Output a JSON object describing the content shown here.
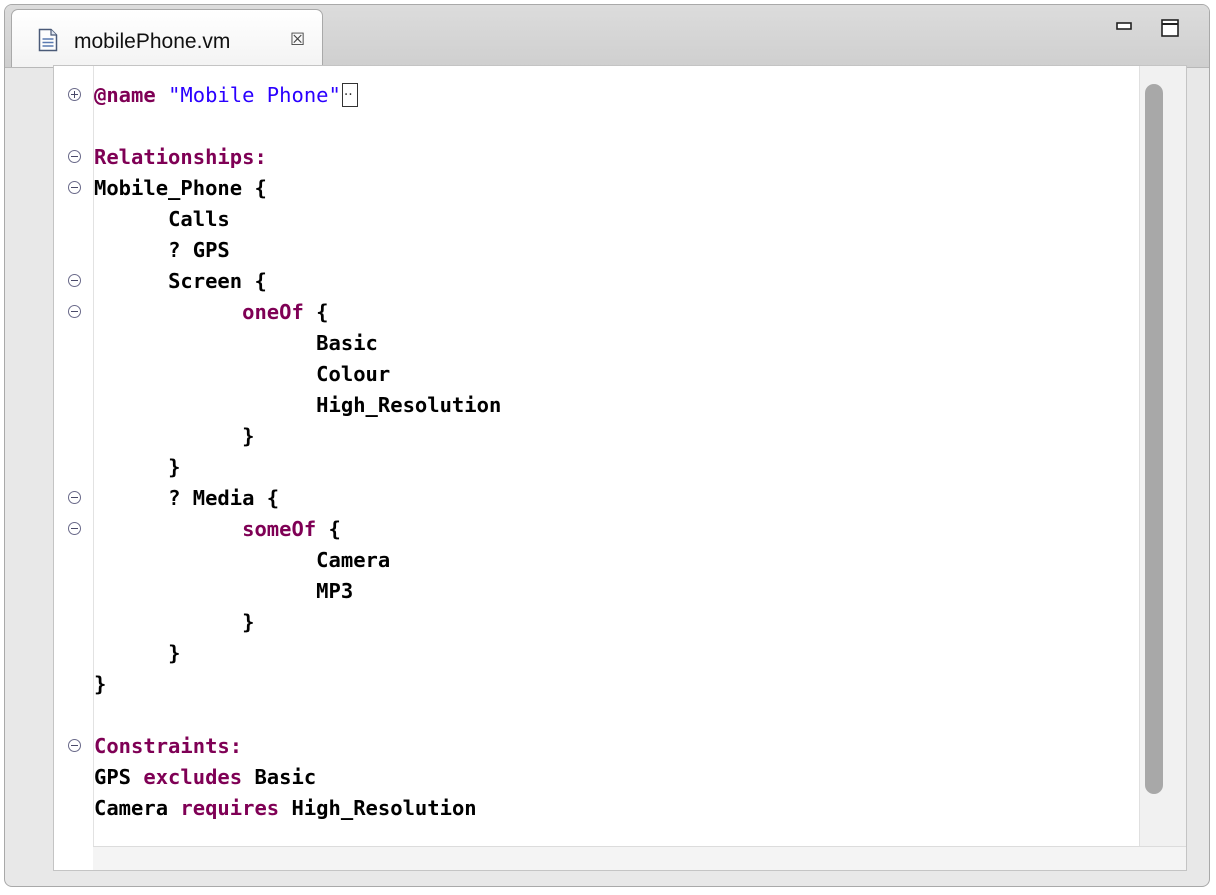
{
  "tab": {
    "file_name": "mobilePhone.vm",
    "close_glyph": "☒"
  },
  "icons": {
    "file": "text-file-icon",
    "close": "close-tab-icon",
    "minimize": "minimize-icon",
    "maximize": "maximize-icon",
    "fold": "fold-toggle-icon"
  },
  "colors": {
    "keyword": "#7f0055",
    "string": "#2a00ff",
    "text": "#000000"
  },
  "code": {
    "l01": {
      "kw": "@name",
      "str": "\"Mobile Phone\"",
      "ellipsis": ".."
    },
    "l03": "Relationships:",
    "l04": "Mobile_Phone {",
    "l05": "Calls",
    "l06": "? GPS",
    "l07": "Screen {",
    "l08": {
      "kw": "oneOf",
      "rest": " {"
    },
    "l09": "Basic",
    "l10": "Colour",
    "l11": "High_Resolution",
    "l12": "}",
    "l13": "}",
    "l14": "? Media {",
    "l15": {
      "kw": "someOf",
      "rest": " {"
    },
    "l16": "Camera",
    "l17": "MP3",
    "l18": "}",
    "l19": "}",
    "l20": "}",
    "l22": "Constraints:",
    "l23": {
      "a": "GPS ",
      "kw": "excludes",
      "b": " Basic"
    },
    "l24": {
      "a": "Camera ",
      "kw": "requires",
      "b": " High_Resolution"
    }
  }
}
